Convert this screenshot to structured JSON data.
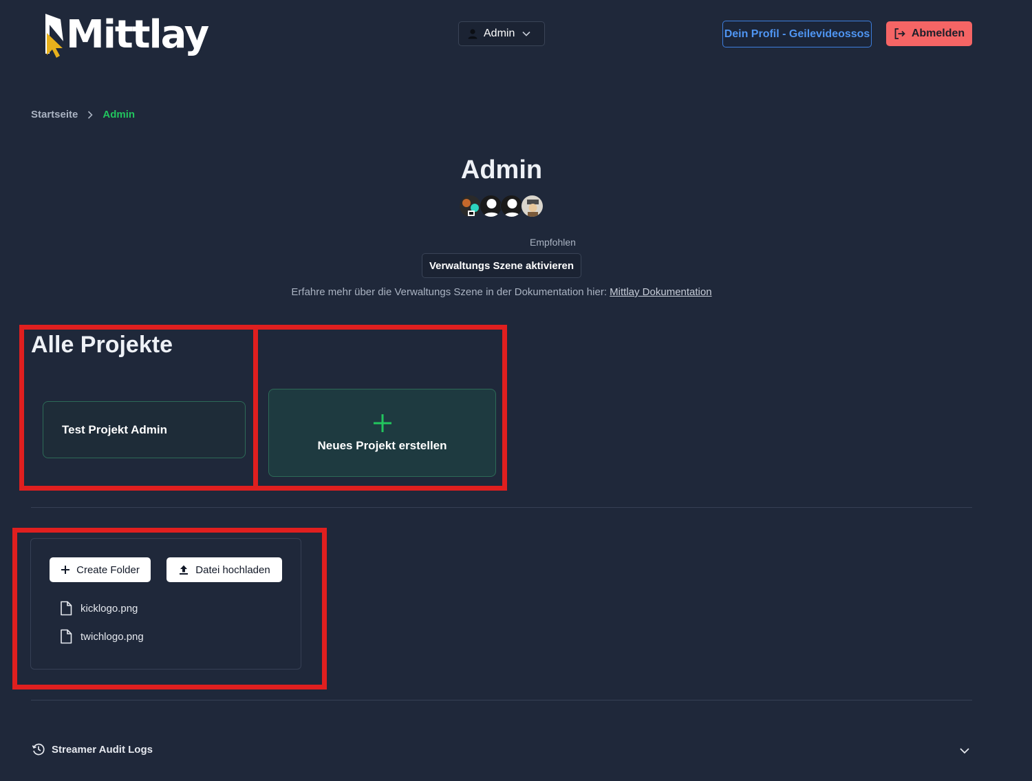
{
  "header": {
    "logo_text": "Mittlay",
    "role_select": {
      "selected": "Admin",
      "icon": "user-icon"
    },
    "profile_button": "Dein Profil - Geilevideossos",
    "logout_button": "Abmelden"
  },
  "breadcrumb": {
    "home": "Startseite",
    "current": "Admin"
  },
  "page": {
    "title": "Admin",
    "avatars": [
      "avatar-1",
      "avatar-2",
      "avatar-3",
      "avatar-4"
    ],
    "recommended_label": "Empfohlen",
    "scene_button": "Verwaltungs Szene aktivieren",
    "doc_text": "Erfahre mehr über die Verwaltungs Szene in der Dokumentation hier: ",
    "doc_link": "Mittlay Dokumentation"
  },
  "projects": {
    "title": "Alle Projekte",
    "items": [
      {
        "name": "Test Projekt Admin"
      }
    ],
    "new_project_label": "Neues Projekt erstellen"
  },
  "files": {
    "create_folder_label": "Create Folder",
    "upload_label": "Datei hochladen",
    "items": [
      {
        "name": "kicklogo.png"
      },
      {
        "name": "twichlogo.png"
      }
    ]
  },
  "audit": {
    "label": "Streamer Audit Logs"
  },
  "colors": {
    "background": "#1f283a",
    "accent_green": "#22c55e",
    "link_blue": "#4f95f2",
    "danger_red": "#f56565",
    "highlight_red": "#e01f1f"
  }
}
